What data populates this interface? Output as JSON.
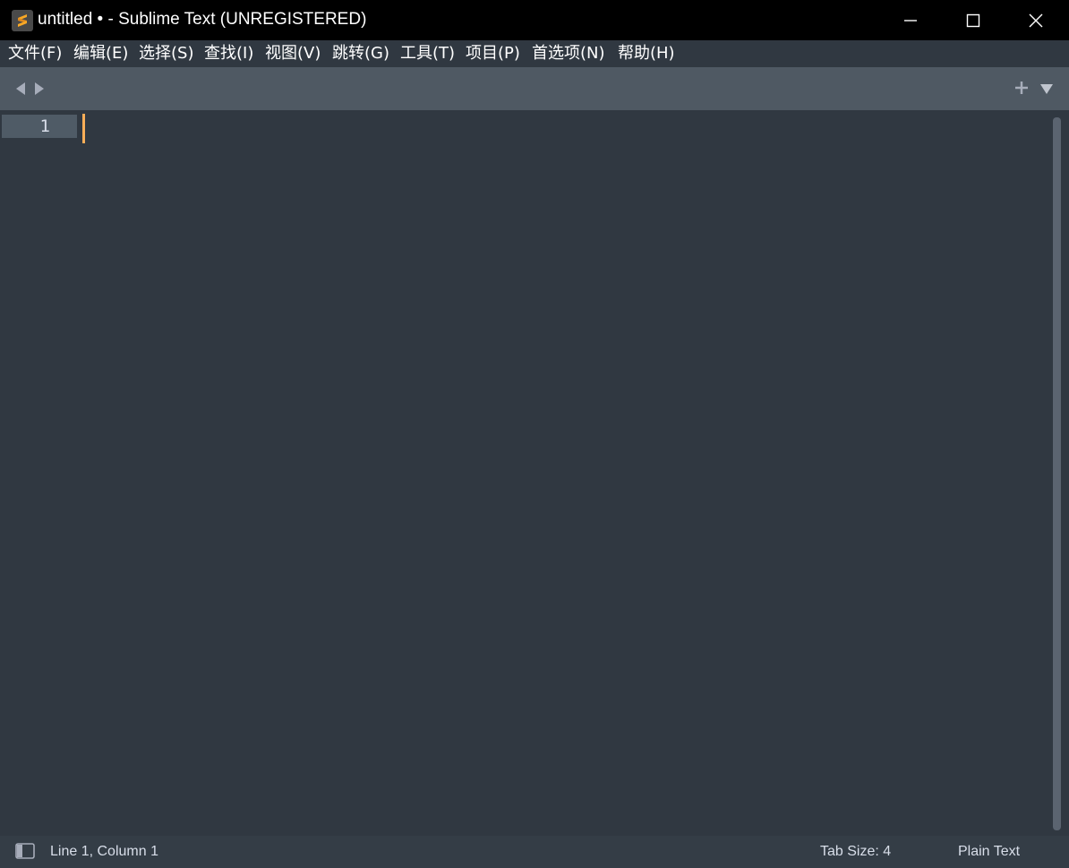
{
  "window": {
    "title": "untitled • - Sublime Text (UNREGISTERED)",
    "controls": {
      "minimize": "minimize-icon",
      "maximize": "maximize-icon",
      "close": "close-icon"
    }
  },
  "menu": {
    "items": [
      {
        "label": "文件(F)"
      },
      {
        "label": "编辑(E)"
      },
      {
        "label": "选择(S)"
      },
      {
        "label": "查找(I)"
      },
      {
        "label": "视图(V)"
      },
      {
        "label": "跳转(G)"
      },
      {
        "label": "工具(T)"
      },
      {
        "label": "项目(P)"
      },
      {
        "label": "首选项(N)"
      },
      {
        "label": "帮助(H)"
      }
    ]
  },
  "tabbar": {
    "icons": [
      "arrow-left-icon",
      "arrow-right-icon",
      "plus-icon",
      "chevron-down-icon"
    ]
  },
  "editor": {
    "line_numbers": [
      "1"
    ],
    "content": ""
  },
  "statusbar": {
    "position": "Line 1, Column 1",
    "tab_size": "Tab Size: 4",
    "syntax": "Plain Text"
  },
  "colors": {
    "titlebar": "#000000",
    "editor_bg": "#303841",
    "tabbar_bg": "#4f5963",
    "caret": "#f9ae58",
    "accent_icon": "#f9a825"
  }
}
